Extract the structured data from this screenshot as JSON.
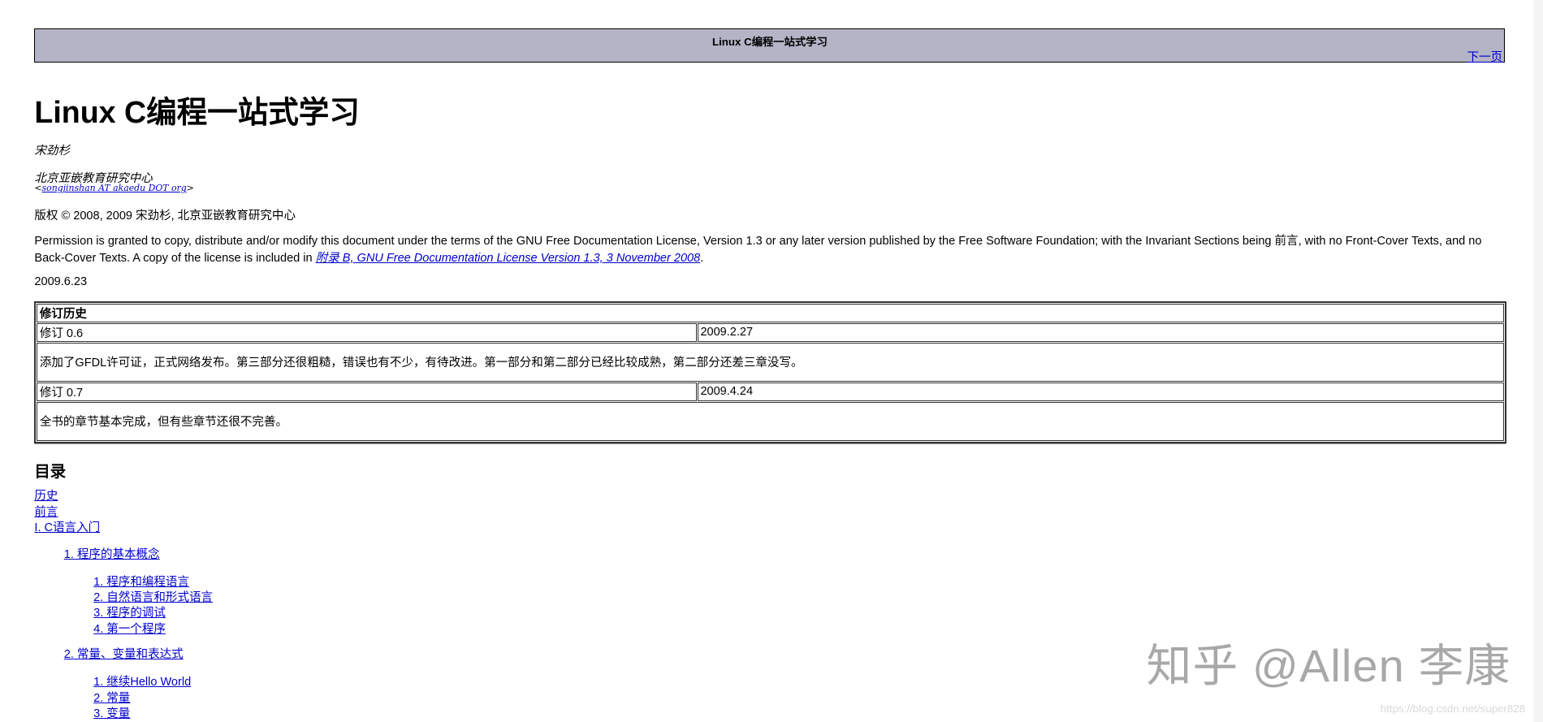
{
  "header": {
    "title": "Linux C编程一站式学习",
    "next_link": "下一页"
  },
  "title": "Linux C编程一站式学习",
  "author": "宋劲杉",
  "org": "北京亚嵌教育研究中心",
  "email": "songjinshan AT akaedu DOT org",
  "copyright": "版权 © 2008, 2009 宋劲杉, 北京亚嵌教育研究中心",
  "permission": {
    "text1": "Permission is granted to copy, distribute and/or modify this document under the terms of the GNU Free Documentation License, Version 1.3 or any later version published by the Free Software Foundation; with the Invariant Sections being 前言, with no Front-Cover Texts, and no Back-Cover Texts. A copy of the license is included in ",
    "link": "附录 B, GNU Free Documentation License Version 1.3, 3 November 2008",
    "text2": "."
  },
  "date": "2009.6.23",
  "history": {
    "heading": "修订历史",
    "rows": [
      {
        "rev": "修订 0.6",
        "date": "2009.2.27",
        "desc": "添加了GFDL许可证，正式网络发布。第三部分还很粗糙，错误也有不少，有待改进。第一部分和第二部分已经比较成熟，第二部分还差三章没写。"
      },
      {
        "rev": "修订 0.7",
        "date": "2009.4.24",
        "desc": "全书的章节基本完成，但有些章节还很不完善。"
      }
    ]
  },
  "toc": {
    "heading": "目录",
    "top": [
      "历史",
      "前言",
      "I. C语言入门"
    ],
    "ch1": "1. 程序的基本概念",
    "ch1_items": [
      "1. 程序和编程语言",
      "2. 自然语言和形式语言",
      "3. 程序的调试",
      "4. 第一个程序"
    ],
    "ch2": "2. 常量、变量和表达式",
    "ch2_items": [
      "1. 继续Hello World",
      "2. 常量",
      "3. 变量"
    ]
  },
  "watermark": "知乎 @Allen 李康",
  "source_url": "https://blog.csdn.net/super828"
}
